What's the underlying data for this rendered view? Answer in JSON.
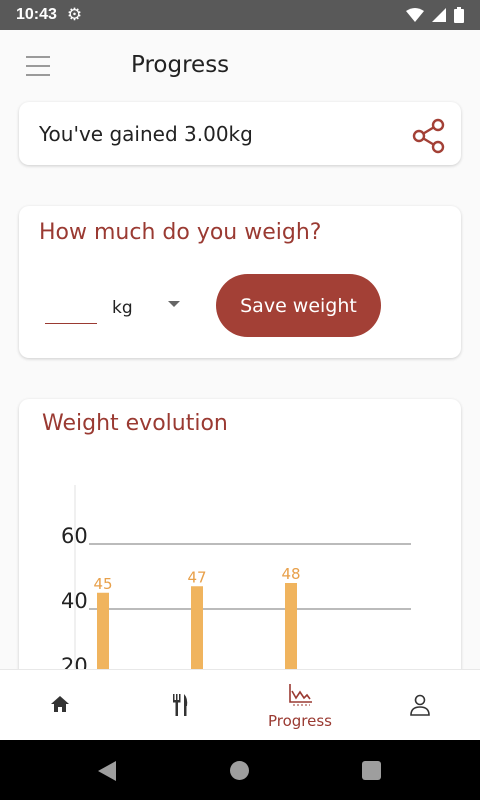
{
  "status_bar": {
    "time": "10:43",
    "icons": [
      "gear-icon",
      "wifi-icon",
      "signal-icon",
      "battery-icon"
    ]
  },
  "app_bar": {
    "title": "Progress",
    "menu_icon": "hamburger-icon"
  },
  "gain_card": {
    "text": "You've gained 3.00kg",
    "share_icon": "share-icon"
  },
  "weight_form": {
    "title": "How much do you weigh?",
    "input_value": "",
    "unit": "kg",
    "save_label": "Save weight"
  },
  "weight_chart": {
    "title": "Weight evolution",
    "chart_data": {
      "type": "bar",
      "title": "Weight evolution",
      "categories": [
        "",
        "",
        ""
      ],
      "values": [
        45,
        47,
        48
      ],
      "data_labels": [
        "45",
        "47",
        "48"
      ],
      "y_ticks": [
        "60",
        "40",
        "20"
      ],
      "grid": true,
      "bar_color": "#f0b45e"
    }
  },
  "bottom_nav": {
    "items": [
      {
        "icon": "home-icon",
        "label": ""
      },
      {
        "icon": "fork-knife-icon",
        "label": ""
      },
      {
        "icon": "progress-chart-icon",
        "label": "Progress",
        "active": true
      },
      {
        "icon": "profile-icon",
        "label": ""
      }
    ]
  },
  "colors": {
    "accent": "#9a3a32",
    "button": "#a34036",
    "bar": "#f0b45e",
    "label": "#e8a04a"
  },
  "system_nav": {
    "icons": [
      "back-icon",
      "home-circle-icon",
      "recents-icon"
    ]
  }
}
